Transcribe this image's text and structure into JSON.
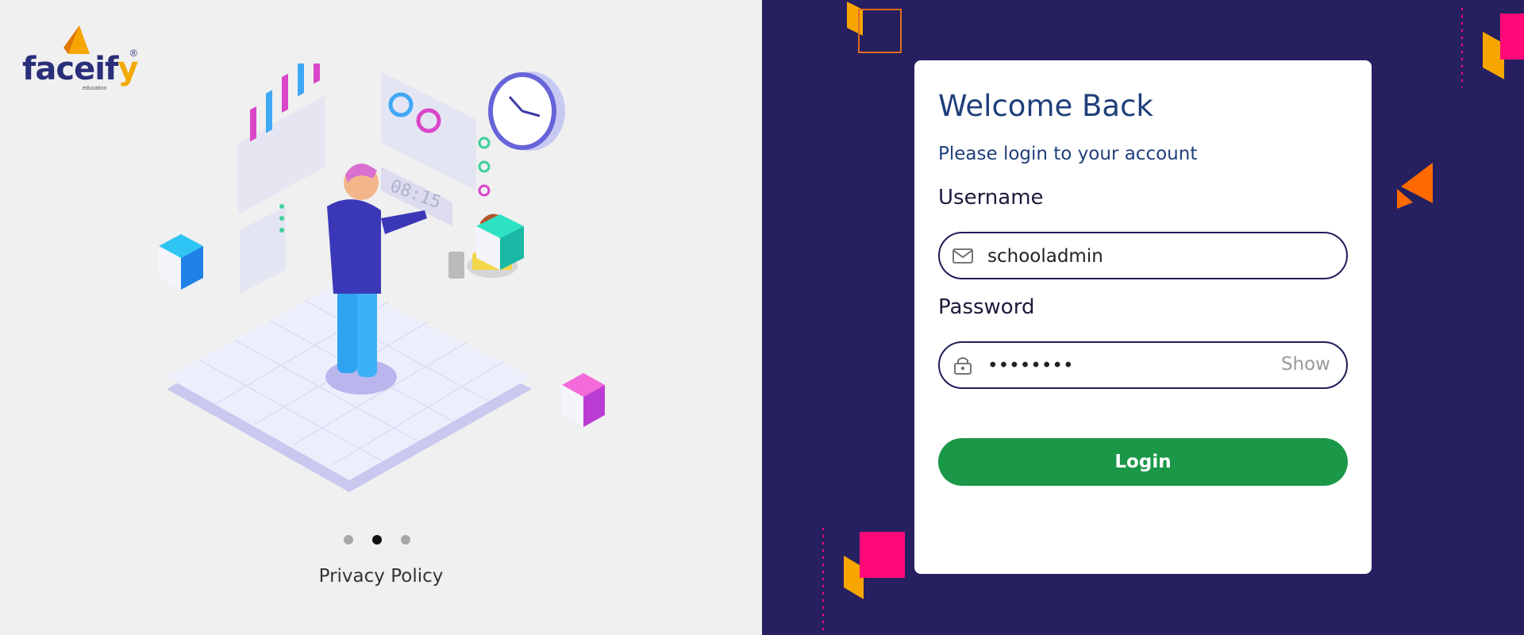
{
  "brand": {
    "logo_text_main": "faceif",
    "logo_text_accent": "y",
    "logo_subtext": "education",
    "logo_registered": "®"
  },
  "carousel": {
    "slide_count": 3,
    "active_index": 1
  },
  "footer": {
    "privacy_label": "Privacy Policy"
  },
  "login": {
    "title": "Welcome Back",
    "subtitle": "Please login to your account",
    "username_label": "Username",
    "username_value": "schooladmin",
    "password_label": "Password",
    "password_value": "••••••••",
    "show_label": "Show",
    "button_label": "Login"
  },
  "icons": {
    "username": "envelope-icon",
    "password": "lock-icon"
  },
  "colors": {
    "left_bg": "#f0f0f0",
    "right_bg": "#261f60",
    "title": "#1f3f7a",
    "button": "#1a9747",
    "field_border": "#1e1e5a",
    "accent_pink": "#ff0a78",
    "accent_orange": "#f7a600"
  }
}
